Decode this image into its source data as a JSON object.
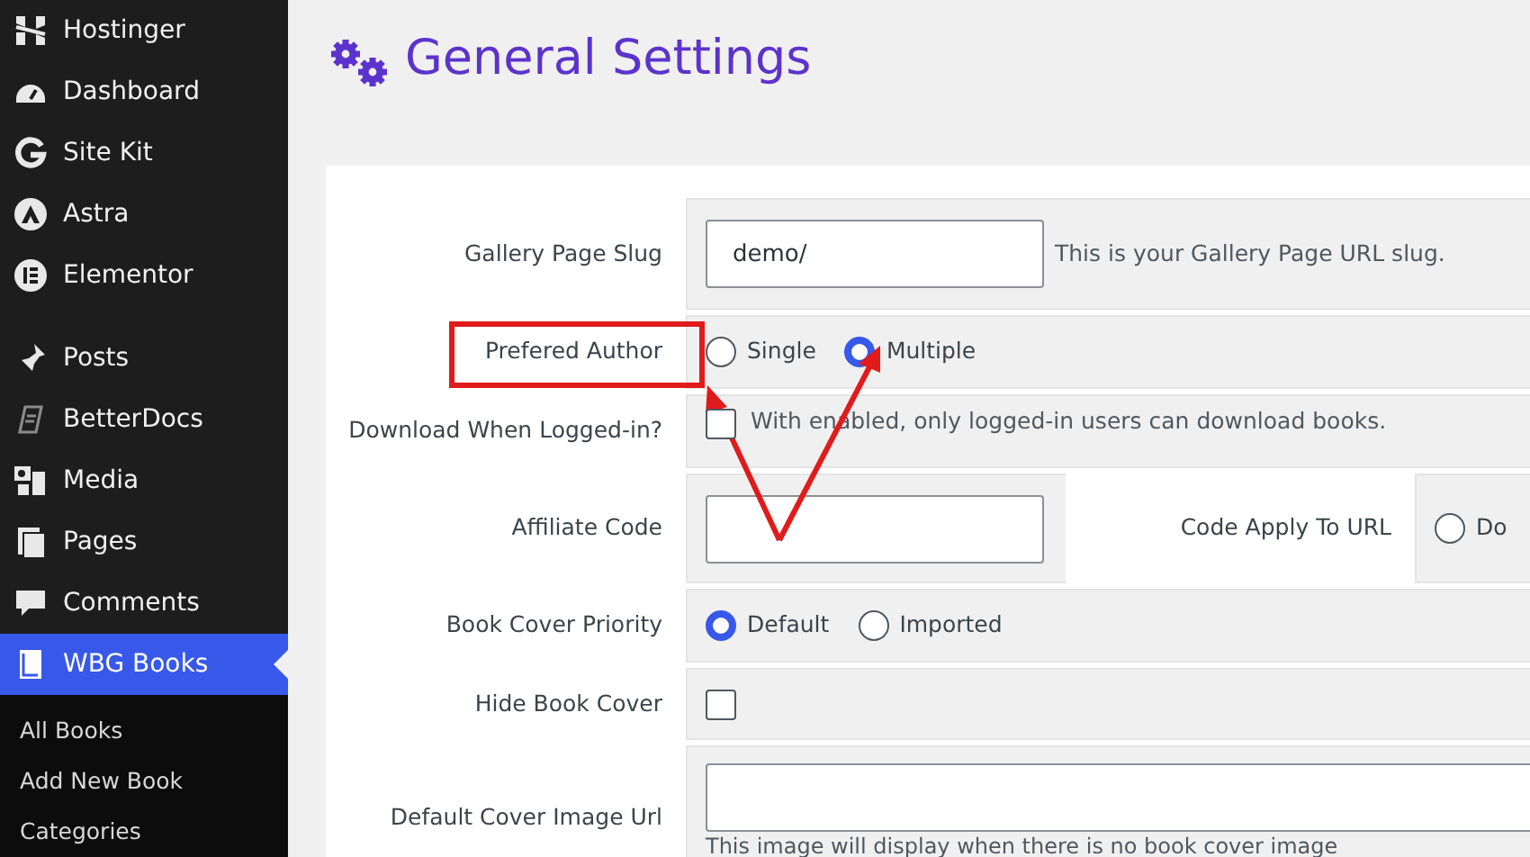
{
  "sidebar": {
    "groups": [
      [
        {
          "label": "Hostinger",
          "selected": false
        },
        {
          "label": "Dashboard",
          "selected": false
        },
        {
          "label": "Site Kit",
          "selected": false
        },
        {
          "label": "Astra",
          "selected": false
        },
        {
          "label": "Elementor",
          "selected": false
        }
      ],
      [
        {
          "label": "Posts",
          "selected": false
        },
        {
          "label": "BetterDocs",
          "selected": false
        },
        {
          "label": "Media",
          "selected": false
        },
        {
          "label": "Pages",
          "selected": false
        },
        {
          "label": "Comments",
          "selected": false
        },
        {
          "label": "WBG Books",
          "selected": true
        }
      ]
    ],
    "submenu": [
      {
        "label": "All Books"
      },
      {
        "label": "Add New Book"
      },
      {
        "label": "Categories"
      }
    ]
  },
  "page": {
    "title": "General Settings"
  },
  "settings": [
    {
      "kind": "text",
      "label": "Gallery Page Slug",
      "value": "demo/",
      "help": "This is your Gallery Page URL slug."
    },
    {
      "kind": "radio",
      "label": "Prefered Author",
      "options": [
        {
          "label": "Single",
          "selected": false
        },
        {
          "label": "Multiple",
          "selected": true
        }
      ]
    },
    {
      "kind": "checkbox",
      "label": "Download When Logged-in?",
      "checked": false,
      "help": "With enabled, only logged-in users can download books."
    },
    {
      "kind": "split",
      "label": "Affiliate Code",
      "second_label": "Code Apply To URL",
      "options": [
        {
          "label": "Do",
          "selected": false
        }
      ]
    },
    {
      "kind": "radio",
      "label": "Book Cover Priority",
      "options": [
        {
          "label": "Default",
          "selected": true
        },
        {
          "label": "Imported",
          "selected": false
        }
      ]
    },
    {
      "kind": "checkbox",
      "label": "Hide Book Cover",
      "checked": false
    },
    {
      "kind": "wide",
      "label": "Default Cover Image Url",
      "help": "This image will display when there is no book cover image"
    }
  ]
}
